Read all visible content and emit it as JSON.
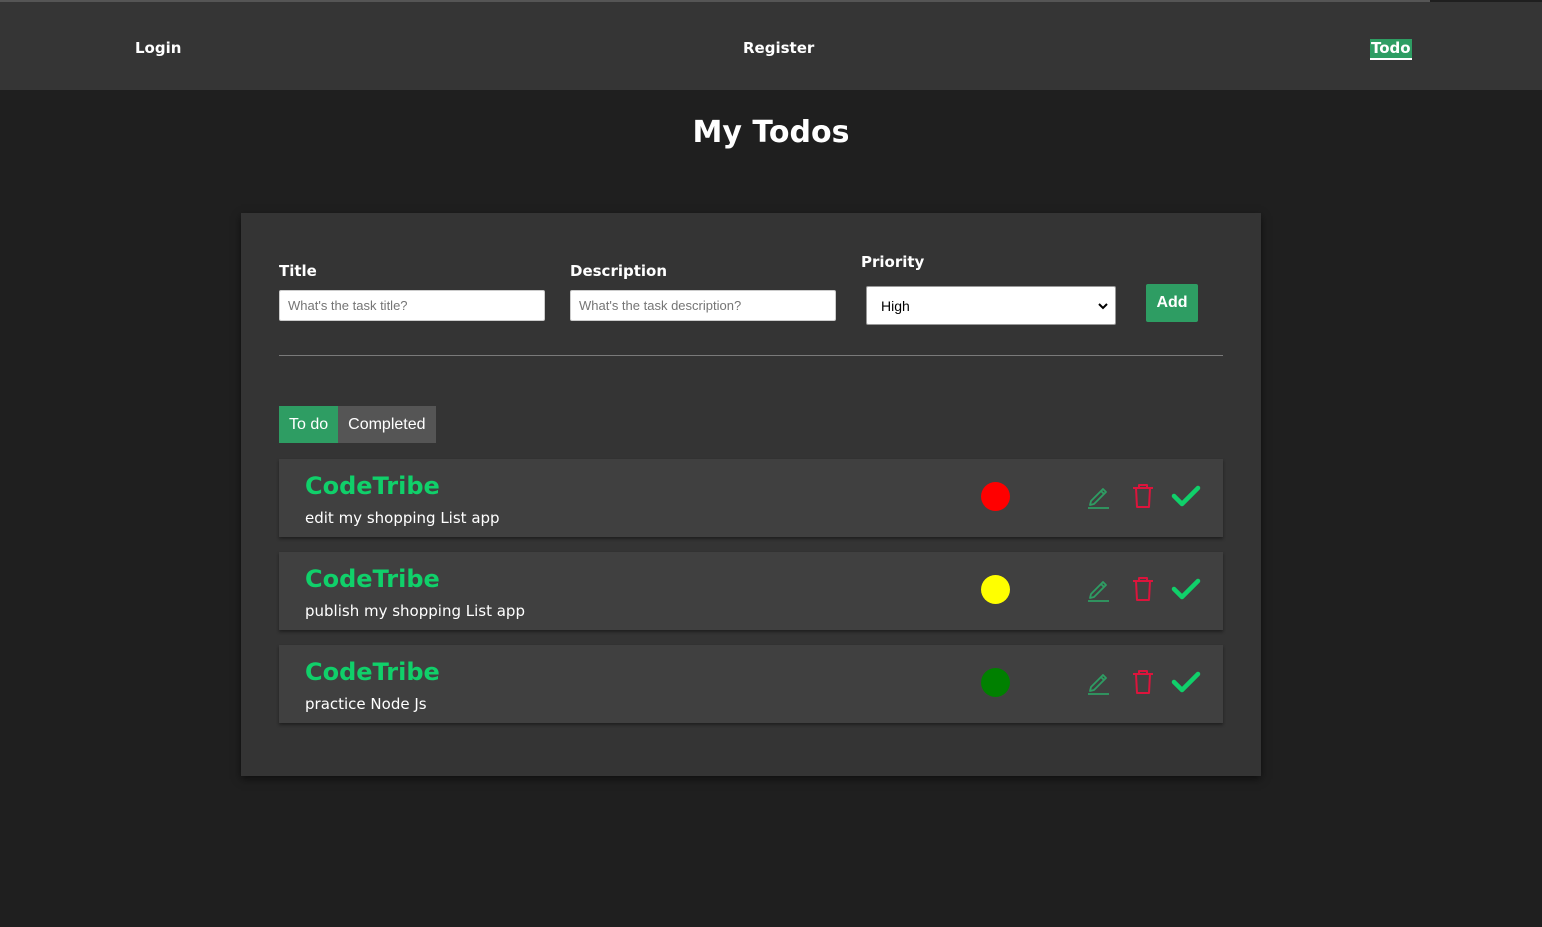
{
  "nav": {
    "login": "Login",
    "register": "Register",
    "todo": "Todo"
  },
  "page": {
    "title": "My Todos"
  },
  "form": {
    "title_label": "Title",
    "title_placeholder": "What's the task title?",
    "description_label": "Description",
    "description_placeholder": "What's the task description?",
    "priority_label": "Priority",
    "priority_selected": "High",
    "add_label": "Add"
  },
  "tabs": {
    "todo": "To do",
    "completed": "Completed"
  },
  "todos": [
    {
      "title": "CodeTribe",
      "description": "edit my shopping List app",
      "priority_color": "#ff0000"
    },
    {
      "title": "CodeTribe",
      "description": "publish my shopping List app",
      "priority_color": "#ffff00"
    },
    {
      "title": "CodeTribe",
      "description": "practice Node Js",
      "priority_color": "#008000"
    }
  ],
  "colors": {
    "accent": "#2e9d63",
    "title_green": "#10d06a",
    "delete_red": "#dc143c"
  }
}
